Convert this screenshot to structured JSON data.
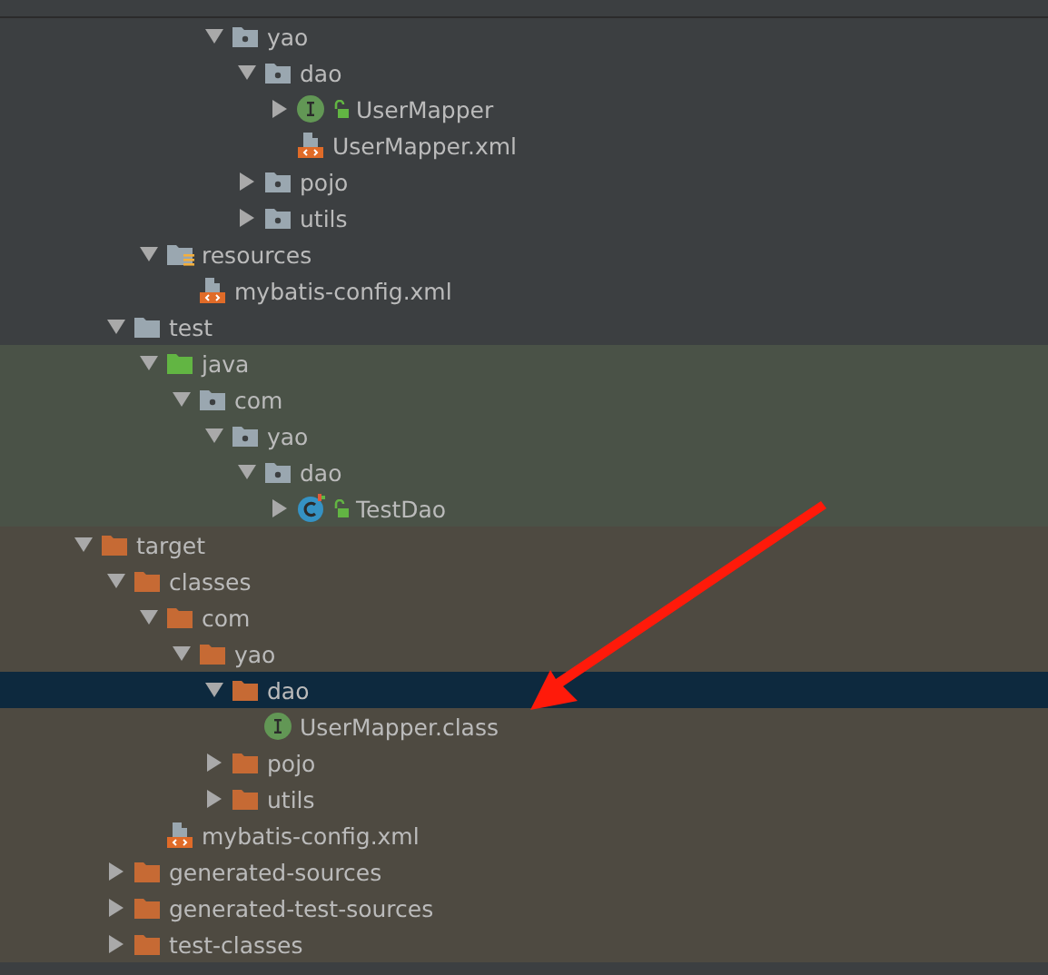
{
  "tree": [
    {
      "children": [
        {
          "children": [
            {
              "children": [
                {
                  "children": [
                    {
                      "label": "yao",
                      "kind": "package",
                      "expanded": true,
                      "selected": false,
                      "children": [
                        {
                          "label": "dao",
                          "kind": "package",
                          "expanded": true,
                          "selected": false,
                          "children": [
                            {
                              "label": "UserMapper",
                              "kind": "interface",
                              "locked": true,
                              "expanded": false,
                              "selected": false
                            },
                            {
                              "label": "UserMapper.xml",
                              "kind": "xml",
                              "selected": false
                            }
                          ]
                        },
                        {
                          "label": "pojo",
                          "kind": "package",
                          "expanded": false,
                          "selected": false
                        },
                        {
                          "label": "utils",
                          "kind": "package",
                          "expanded": false,
                          "selected": false
                        }
                      ]
                    }
                  ]
                }
              ]
            },
            {
              "label": "resources",
              "kind": "resources",
              "expanded": true,
              "selected": false,
              "children": [
                {
                  "label": "mybatis-config.xml",
                  "kind": "xml",
                  "selected": false
                }
              ]
            }
          ]
        },
        {
          "label": "test",
          "kind": "folder",
          "expanded": true,
          "selected": false,
          "children": [
            {
              "label": "java",
              "kind": "test-source",
              "expanded": true,
              "selected": false,
              "children": [
                {
                  "label": "com",
                  "kind": "package",
                  "expanded": true,
                  "selected": false,
                  "children": [
                    {
                      "label": "yao",
                      "kind": "package",
                      "expanded": true,
                      "selected": false,
                      "children": [
                        {
                          "label": "dao",
                          "kind": "package",
                          "expanded": true,
                          "selected": false,
                          "children": [
                            {
                              "label": "TestDao",
                              "kind": "class",
                              "locked": true,
                              "expanded": false,
                              "selected": false
                            }
                          ]
                        }
                      ]
                    }
                  ]
                }
              ]
            }
          ]
        }
      ]
    },
    {
      "label": "target",
      "kind": "excluded",
      "expanded": true,
      "selected": false,
      "children": [
        {
          "label": "classes",
          "kind": "excluded",
          "expanded": true,
          "selected": false,
          "children": [
            {
              "label": "com",
              "kind": "excluded",
              "expanded": true,
              "selected": false,
              "children": [
                {
                  "label": "yao",
                  "kind": "excluded",
                  "expanded": true,
                  "selected": false,
                  "children": [
                    {
                      "label": "dao",
                      "kind": "excluded",
                      "expanded": true,
                      "selected": true,
                      "children": [
                        {
                          "label": "UserMapper.class",
                          "kind": "class-file",
                          "selected": false
                        }
                      ]
                    },
                    {
                      "label": "pojo",
                      "kind": "excluded",
                      "expanded": false,
                      "selected": false
                    },
                    {
                      "label": "utils",
                      "kind": "excluded",
                      "expanded": false,
                      "selected": false
                    }
                  ]
                }
              ]
            },
            {
              "label": "mybatis-config.xml",
              "kind": "xml",
              "selected": false
            }
          ]
        },
        {
          "label": "generated-sources",
          "kind": "excluded",
          "expanded": false,
          "selected": false
        },
        {
          "label": "generated-test-sources",
          "kind": "excluded",
          "expanded": false,
          "selected": false
        },
        {
          "label": "test-classes",
          "kind": "excluded",
          "expanded": false,
          "selected": false
        }
      ]
    }
  ]
}
